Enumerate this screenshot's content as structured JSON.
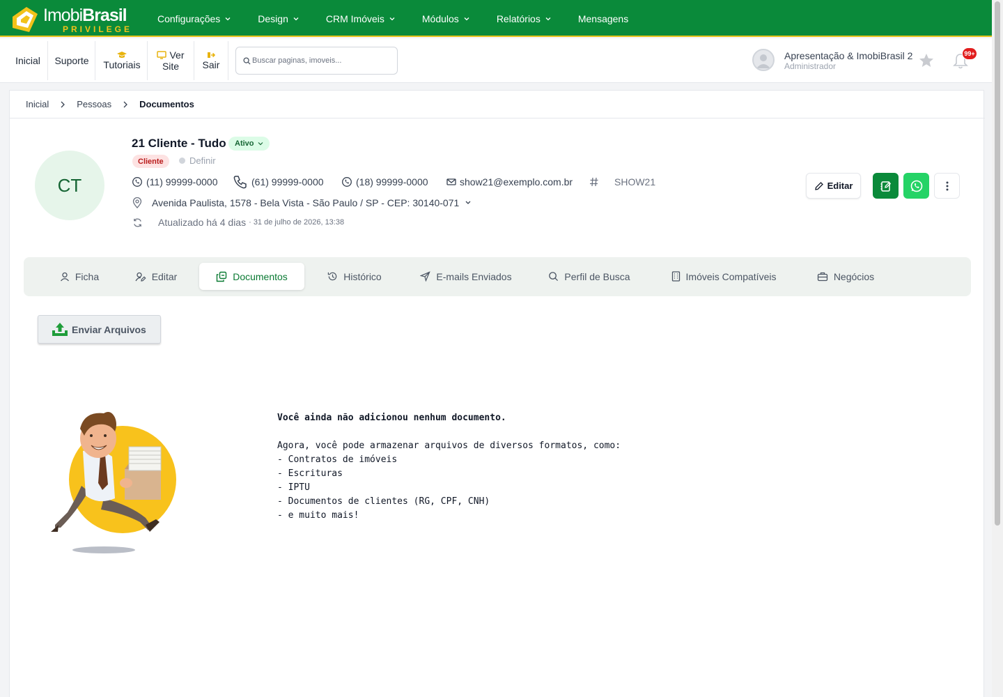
{
  "brand": {
    "name_light": "Imobi",
    "name_bold": "Brasil",
    "tagline": "PRIVILEGE"
  },
  "menu": [
    {
      "label": "Configurações"
    },
    {
      "label": "Design"
    },
    {
      "label": "CRM Imóveis"
    },
    {
      "label": "Módulos"
    },
    {
      "label": "Relatórios"
    },
    {
      "label": "Mensagens"
    }
  ],
  "quicklinks": {
    "inicial": "Inicial",
    "suporte": "Suporte",
    "tutoriais": "Tutoriais",
    "ver": "Ver",
    "site": "Site",
    "sair": "Sair"
  },
  "search": {
    "placeholder": "Buscar paginas, imoveis..."
  },
  "user": {
    "name": "Apresentação & ImobiBrasil 2",
    "role": "Administrador",
    "notifications": "99+"
  },
  "breadcrumb": [
    "Inicial",
    "Pessoas",
    "Documentos"
  ],
  "person": {
    "initials": "CT",
    "name": "21 Cliente - Tudo",
    "status": "Ativo",
    "type": "Cliente",
    "define_label": "Definir",
    "phone1": "(11) 99999-0000",
    "phone2": "(61) 99999-0000",
    "phone3": "(18) 99999-0000",
    "email": "show21@exemplo.com.br",
    "code": "SHOW21",
    "address": "Avenida Paulista, 1578 - Bela Vista - São Paulo / SP - CEP: 30140-071",
    "updated": "Atualizado há 4 dias",
    "updated_detail": "· 31 de julho de 2026, 13:38"
  },
  "actions": {
    "edit": "Editar"
  },
  "tabs": [
    {
      "label": "Ficha"
    },
    {
      "label": "Editar"
    },
    {
      "label": "Documentos"
    },
    {
      "label": "Histórico"
    },
    {
      "label": "E-mails Enviados"
    },
    {
      "label": "Perfil de Busca"
    },
    {
      "label": "Imóveis Compatíveis"
    },
    {
      "label": "Negócios"
    }
  ],
  "upload": {
    "label": "Enviar Arquivos"
  },
  "empty": {
    "title": "Você ainda não adicionou nenhum documento.",
    "intro": "Agora, você pode armazenar arquivos de diversos formatos, como:",
    "items": [
      "- Contratos de imóveis",
      "- Escrituras",
      "- IPTU",
      "- Documentos de clientes (RG, CPF, CNH)",
      "- e muito mais!"
    ]
  },
  "colors": {
    "brand_green": "#0a8a3a",
    "brand_yellow": "#e8c21a",
    "whatsapp": "#25d366",
    "active_tab": "#0a7a33"
  }
}
